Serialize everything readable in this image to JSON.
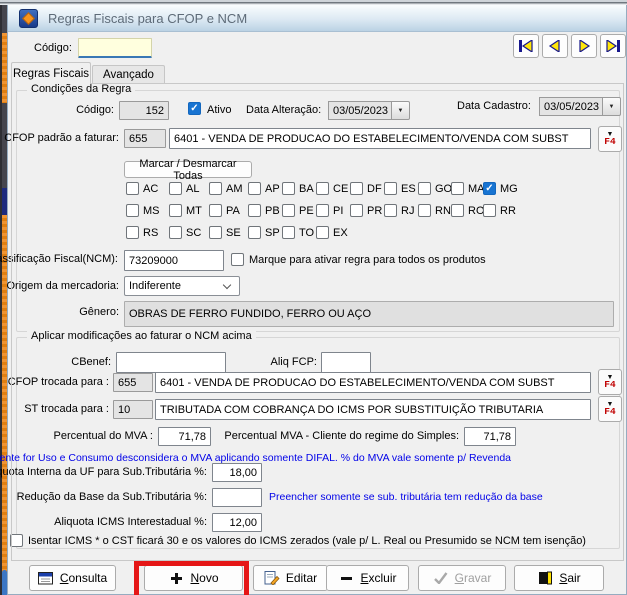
{
  "window": {
    "title": "Regras Fiscais para CFOP e NCM",
    "icon": "app-diamond-icon"
  },
  "header": {
    "codigo_label": "Código:",
    "codigo_value": "",
    "nav_buttons": [
      {
        "id": "first",
        "name": "nav-first-button"
      },
      {
        "id": "prev",
        "name": "nav-previous-button"
      },
      {
        "id": "next",
        "name": "nav-next-button"
      },
      {
        "id": "last",
        "name": "nav-last-button"
      }
    ]
  },
  "tabs": [
    {
      "label": "Regras Fiscais",
      "active": true
    },
    {
      "label": "Avançado",
      "active": false
    }
  ],
  "conditions": {
    "title": "Condições da Regra",
    "codigo_label": "Código:",
    "codigo_value": "152",
    "ativo_label": "Ativo",
    "ativo_checked": true,
    "data_alteracao_label": "Data Alteração:",
    "data_alteracao_value": "03/05/2023",
    "data_cadastro_label": "Data Cadastro:",
    "data_cadastro_value": "03/05/2023",
    "cfop_label": "CFOP padrão a faturar:",
    "cfop_code": "655",
    "cfop_desc": "6401 - VENDA DE PRODUCAO DO ESTABELECIMENTO/VENDA COM SUBST",
    "f4_label": "F4",
    "marcar_button_label": "Marcar / Desmarcar Todas",
    "states": {
      "rows": [
        [
          "AC",
          "AL",
          "AM",
          "AP",
          "BA",
          "CE",
          "DF",
          "ES",
          "GO",
          "MA",
          "MG"
        ],
        [
          "MS",
          "MT",
          "PA",
          "PB",
          "PE",
          "PI",
          "PR",
          "RJ",
          "RN",
          "RO",
          "RR"
        ],
        [
          "RS",
          "SC",
          "SE",
          "SP",
          "TO",
          "EX"
        ]
      ],
      "checked": [
        "MG"
      ]
    },
    "ncm_label": "Classificação Fiscal(NCM):",
    "ncm_value": "73209000",
    "todos_produtos_label": "Marque para ativar regra para todos os produtos",
    "todos_produtos_checked": false,
    "origem_label": "Origem da mercadoria:",
    "origem_value": "Indiferente",
    "genero_label": "Gênero:",
    "genero_value": "OBRAS DE FERRO FUNDIDO, FERRO OU AÇO"
  },
  "modifications": {
    "title": "Aplicar modificações ao faturar o NCM acima",
    "cbenef_label": "CBenef:",
    "cbenef_value": "",
    "aliq_fcp_label": "Aliq FCP:",
    "aliq_fcp_value": "",
    "cfop_trocada_label": "CFOP trocada para :",
    "cfop_trocada_code": "655",
    "cfop_trocada_desc": "6401 - VENDA DE PRODUCAO DO ESTABELECIMENTO/VENDA COM SUBST",
    "st_trocada_label": "ST trocada para :",
    "st_trocada_code": "10",
    "st_trocada_desc": "TRIBUTADA COM COBRANÇA DO ICMS POR SUBSTITUIÇÃO TRIBUTARIA",
    "mva_label": "Percentual do MVA :",
    "mva_value": "71,78",
    "mva_simples_label": "Percentual MVA - Cliente do regime do Simples:",
    "mva_simples_value": "71,78",
    "mva_note": "Se cliente for Uso e Consumo desconsidera o MVA aplicando somente DIFAL. % do MVA vale somente p/ Revenda",
    "aliq_interna_label": "Aliquota Interna da UF para Sub.Tributária %:",
    "aliq_interna_value": "18,00",
    "reducao_label": "Redução da Base da Sub.Tributária %:",
    "reducao_value": "",
    "reducao_note": "Preencher somente se sub. tributária tem redução da base",
    "aliq_interestadual_label": "Aliquota ICMS Interestadual %:",
    "aliq_interestadual_value": "12,00",
    "isentar_label": "Isentar ICMS * o CST ficará 30 e os valores do ICMS zerados (vale p/ L. Real ou Presumido se NCM tem isenção)",
    "isentar_checked": false
  },
  "footer": {
    "buttons": [
      {
        "id": "consulta",
        "label": "Consulta",
        "accel": "C",
        "icon": "window-icon",
        "name": "consulta-button"
      },
      {
        "id": "novo",
        "label": "Novo",
        "accel": "N",
        "icon": "plus-icon",
        "name": "novo-button",
        "highlighted": true
      },
      {
        "id": "editar",
        "label": "Editar",
        "accel": "",
        "icon": "edit-icon",
        "name": "editar-button"
      },
      {
        "id": "excluir",
        "label": "Excluir",
        "accel": "E",
        "icon": "minus-icon",
        "name": "excluir-button"
      },
      {
        "id": "gravar",
        "label": "Gravar",
        "accel": "G",
        "icon": "check-icon",
        "name": "gravar-button",
        "disabled": true
      },
      {
        "id": "sair",
        "label": "Sair",
        "accel": "S",
        "icon": "door-icon",
        "name": "sair-button"
      }
    ]
  },
  "annotation": {
    "type": "red-highlight-box",
    "target": "novo-button"
  },
  "colors": {
    "checkbox_checked": "#1874D2",
    "note_blue": "#0202E8",
    "f4_red": "#C00000",
    "annotation_red": "#E51616",
    "strip_orange": "#E8851C",
    "nav_arrow_yellow": "#FFE60A",
    "nav_arrow_navy": "#17178C",
    "titlebar_gradient_bottom": "#BBD2E4"
  }
}
